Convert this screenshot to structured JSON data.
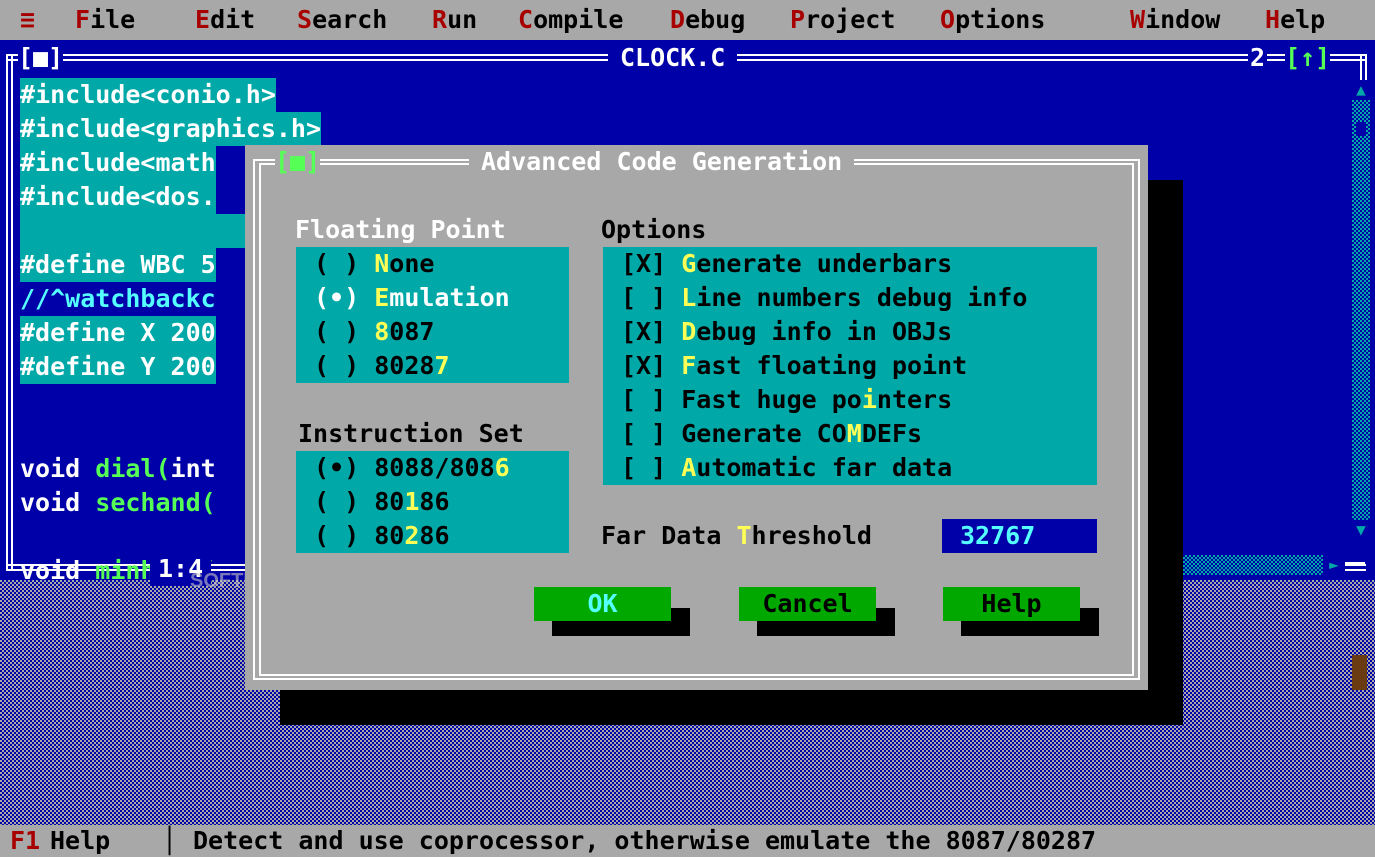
{
  "menu": {
    "system": "≡",
    "items": [
      {
        "hot": "F",
        "rest": "ile"
      },
      {
        "hot": "E",
        "rest": "dit"
      },
      {
        "hot": "S",
        "rest": "earch"
      },
      {
        "hot": "R",
        "rest": "un"
      },
      {
        "hot": "C",
        "rest": "ompile"
      },
      {
        "hot": "D",
        "rest": "ebug"
      },
      {
        "hot": "P",
        "rest": "roject"
      },
      {
        "hot": "O",
        "rest": "ptions"
      },
      {
        "hot": "W",
        "rest": "indow"
      },
      {
        "hot": "H",
        "rest": "elp"
      }
    ]
  },
  "editor": {
    "close_box": "[■]",
    "title": "CLOCK.C",
    "window_num": "2",
    "zoom_box": "[↑]",
    "cursor_pos": "1:4",
    "lines": [
      {
        "text": "#include<conio.h>",
        "selected": true
      },
      {
        "text": "#include<graphics.h>",
        "selected": true
      },
      {
        "text": "#include<math",
        "selected": true
      },
      {
        "text": "#include<dos.",
        "selected": true
      },
      {
        "text": "",
        "selected": true
      },
      {
        "text": "#define WBC 5",
        "selected": true
      },
      {
        "text": "//^watchbackc",
        "selected": true
      },
      {
        "text": "#define X 200",
        "selected": true
      },
      {
        "text": "#define Y 200",
        "selected": true
      },
      {
        "text": "",
        "selected": false
      },
      {
        "kw": "void ",
        "fn": "dial(",
        "rest": "int",
        "selected": false
      },
      {
        "kw": "void ",
        "fn": "sechand(",
        "rest": "",
        "selected": false
      },
      {
        "text": "",
        "selected": false
      },
      {
        "kw": "void ",
        "fn": "minhand(",
        "rest": "",
        "selected": false
      }
    ]
  },
  "dialog": {
    "close_box": "[■]",
    "title": "Advanced Code Generation",
    "floating_point": {
      "label": "Floating Point",
      "options": [
        {
          "mark": "( )",
          "pre": "",
          "hot": "N",
          "post": "one"
        },
        {
          "mark": "(•)",
          "pre": "",
          "hot": "E",
          "post": "mulation"
        },
        {
          "mark": "( )",
          "pre": "",
          "hot": "8",
          "post": "087"
        },
        {
          "mark": "( )",
          "pre": "8028",
          "hot": "7",
          "post": ""
        }
      ]
    },
    "instruction_set": {
      "label": "Instruction Set",
      "options": [
        {
          "mark": "(•)",
          "pre": "8088/808",
          "hot": "6",
          "post": ""
        },
        {
          "mark": "( )",
          "pre": "80",
          "hot": "1",
          "post": "86"
        },
        {
          "mark": "( )",
          "pre": "80",
          "hot": "2",
          "post": "86"
        }
      ]
    },
    "options": {
      "label": "Options",
      "items": [
        {
          "mark": "[X]",
          "pre": "",
          "hot": "G",
          "post": "enerate underbars"
        },
        {
          "mark": "[ ]",
          "pre": "",
          "hot": "L",
          "post": "ine numbers debug info"
        },
        {
          "mark": "[X]",
          "pre": "",
          "hot": "D",
          "post": "ebug info in OBJs"
        },
        {
          "mark": "[X]",
          "pre": "",
          "hot": "F",
          "post": "ast floating point"
        },
        {
          "mark": "[ ]",
          "pre": "Fast huge po",
          "hot": "i",
          "post": "nters"
        },
        {
          "mark": "[ ]",
          "pre": "Generate CO",
          "hot": "M",
          "post": "DEFs"
        },
        {
          "mark": "[ ]",
          "pre": "",
          "hot": "A",
          "post": "utomatic far data"
        }
      ]
    },
    "far_data": {
      "pre": "Far Data ",
      "hot": "T",
      "post": "hreshold",
      "value": "32767"
    },
    "buttons": {
      "ok": "OK",
      "cancel": "Cancel",
      "help": "Help"
    }
  },
  "status": {
    "key": "F1",
    "key_label": "Help",
    "separator": "│",
    "message": "Detect and use coprocessor, otherwise emulate the 8087/80287"
  },
  "watermark": "SOFTPEDIA"
}
